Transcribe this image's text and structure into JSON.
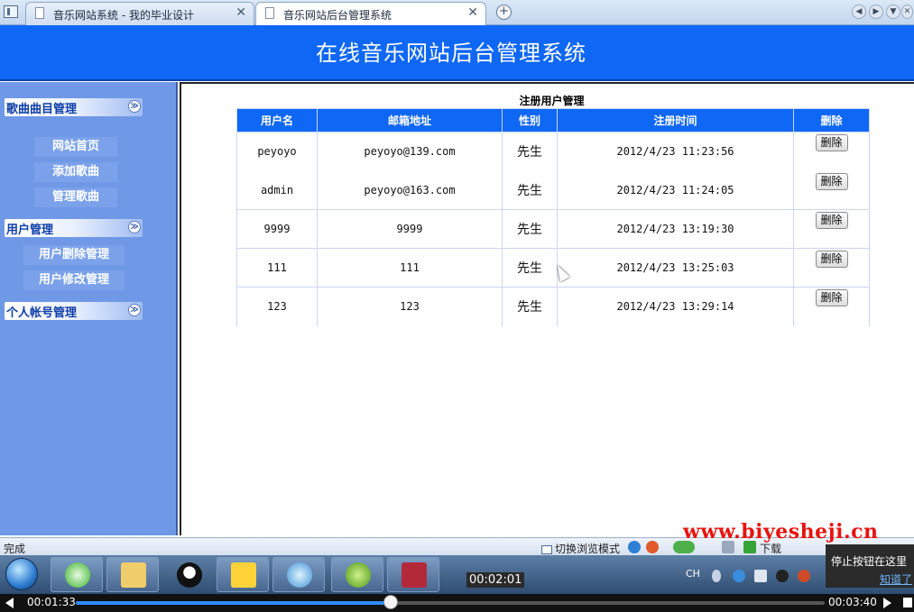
{
  "browser": {
    "tabs": [
      {
        "label": "音乐网站系统 - 我的毕业设计",
        "close": "✕",
        "active": false
      },
      {
        "label": "音乐网站后台管理系统",
        "close": "✕",
        "active": true
      }
    ],
    "new_tab": "+"
  },
  "header": {
    "title": "在线音乐网站后台管理系统"
  },
  "sidebar": {
    "groups": [
      {
        "label": "歌曲曲目管理",
        "chevron": "≫"
      },
      {
        "label": "用户管理",
        "chevron": "≫"
      },
      {
        "label": "个人帐号管理",
        "chevron": "≫"
      }
    ],
    "items": [
      "网站首页",
      "添加歌曲",
      "管理歌曲",
      "用户删除管理",
      "用户修改管理"
    ]
  },
  "main": {
    "caption": "注册用户管理",
    "columns": [
      "用户名",
      "邮箱地址",
      "性别",
      "注册时间",
      "删除"
    ],
    "delete_label": "删除",
    "rows": [
      {
        "username": "peyoyo",
        "email": "peyoyo@139.com",
        "gender": "先生",
        "registered": "2012/4/23 11:23:56"
      },
      {
        "username": "admin",
        "email": "peyoyo@163.com",
        "gender": "先生",
        "registered": "2012/4/23 11:24:05"
      },
      {
        "username": "9999",
        "email": "9999",
        "gender": "先生",
        "registered": "2012/4/23 13:19:30"
      },
      {
        "username": "111",
        "email": "111",
        "gender": "先生",
        "registered": "2012/4/23 13:25:03"
      },
      {
        "username": "123",
        "email": "123",
        "gender": "先生",
        "registered": "2012/4/23 13:29:14"
      }
    ]
  },
  "statusbar": {
    "status": "完成",
    "mode_toggle": "切换浏览模式",
    "download": "下载"
  },
  "watermark": "www.biyesheji.cn",
  "taskbar": {
    "ime": "CH"
  },
  "tooltip": {
    "text": "停止按钮在这里",
    "link": "知道了"
  },
  "player": {
    "elapsed": "00:01:33",
    "hover_time": "00:02:01",
    "total": "00:03:40",
    "progress": 0.42
  },
  "colors": {
    "banner": "#0f67f5",
    "sidebar": "#6f98e6",
    "table_header": "#0f67f5",
    "watermark": "#e8130f",
    "progress": "#2f8cff"
  }
}
